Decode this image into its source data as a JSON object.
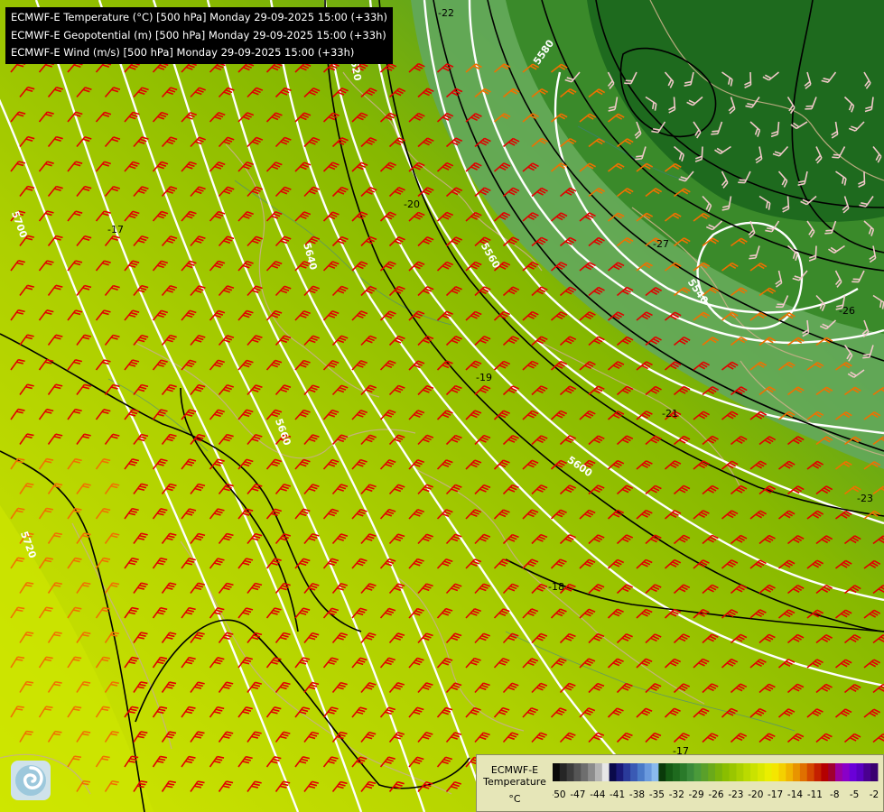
{
  "title_lines": [
    "ECMWF-E Temperature (°C) [500 hPa] Monday 29-09-2025 15:00 (+33h)",
    "ECMWF-E Geopotential (m) [500 hPa] Monday 29-09-2025 15:00 (+33h)",
    "ECMWF-E Wind (m/s) [500 hPa] Monday 29-09-2025 15:00 (+33h)"
  ],
  "geopotential_labels": [
    "5560",
    "5580",
    "5540",
    "5600",
    "5620",
    "5640",
    "5660",
    "5700",
    "5720"
  ],
  "temperature_labels": [
    "-22",
    "-20",
    "-19",
    "-17",
    "-26",
    "-27",
    "-23",
    "-21",
    "-18",
    "-17"
  ],
  "legend": {
    "title": "ECMWF-E Temperature",
    "unit": "°C",
    "ticks": [
      "-50",
      "-47",
      "-44",
      "-41",
      "-38",
      "-35",
      "-32",
      "-29",
      "-26",
      "-23",
      "-20",
      "-17",
      "-14",
      "-11",
      "-8",
      "-5",
      "-2"
    ],
    "colors": [
      "#0a0a0a",
      "#262626",
      "#3c3c3c",
      "#555555",
      "#6e6e6e",
      "#8c8c8c",
      "#b4b4b4",
      "#e6e6e6",
      "#0a0a4a",
      "#1a1a78",
      "#2a3a9a",
      "#3a5ab4",
      "#4a7ac8",
      "#6a9ade",
      "#8abaee",
      "#0a3a0a",
      "#145a14",
      "#1e6a1e",
      "#2a7a2a",
      "#3a8a3a",
      "#4a9a3a",
      "#5aa02a",
      "#6aaa1a",
      "#7ab40a",
      "#8abe00",
      "#9ac600",
      "#aad000",
      "#bada00",
      "#cae200",
      "#dae800",
      "#eaee00",
      "#f4e600",
      "#f4d000",
      "#f0b400",
      "#e89400",
      "#e07000",
      "#d44800",
      "#c42000",
      "#b40000",
      "#a00030",
      "#9a00a0",
      "#8a00c8",
      "#6a00d8",
      "#5a00c0",
      "#4a0090",
      "#3a0070"
    ],
    "accent_colors": {
      "warm_air": "#c8e200",
      "cold_core": "#1e6a1e",
      "barb_red": "#e00000",
      "barb_orange": "#f07000",
      "barb_pink": "#f0c8c8"
    }
  }
}
